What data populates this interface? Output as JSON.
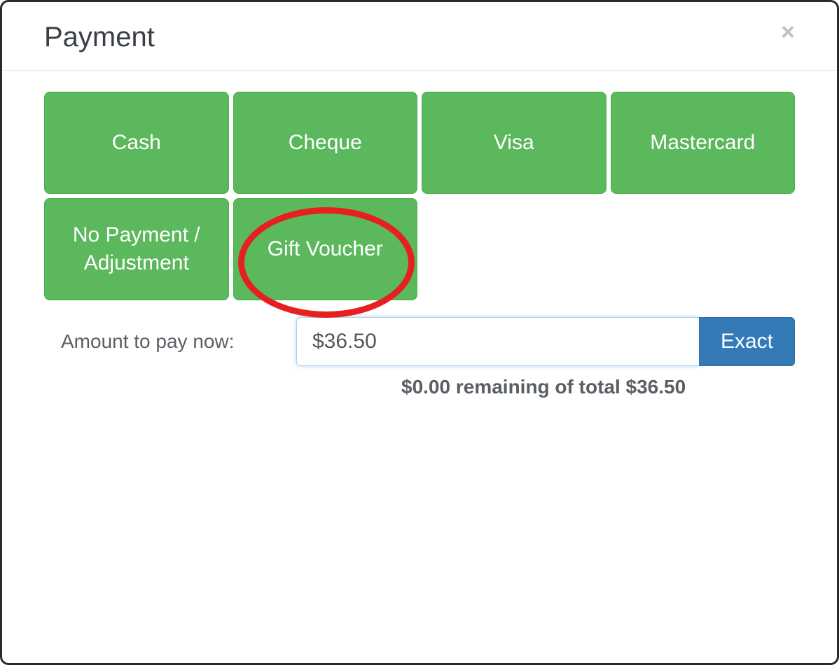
{
  "modal": {
    "title": "Payment",
    "close_label": "×"
  },
  "payment_methods": {
    "cash": "Cash",
    "cheque": "Cheque",
    "visa": "Visa",
    "mastercard": "Mastercard",
    "no_payment": "No Payment / Adjustment",
    "gift_voucher": "Gift Voucher"
  },
  "amount": {
    "label": "Amount to pay now:",
    "value": "$36.50",
    "exact_label": "Exact",
    "remaining_text": "$0.00 remaining of total $36.50"
  }
}
